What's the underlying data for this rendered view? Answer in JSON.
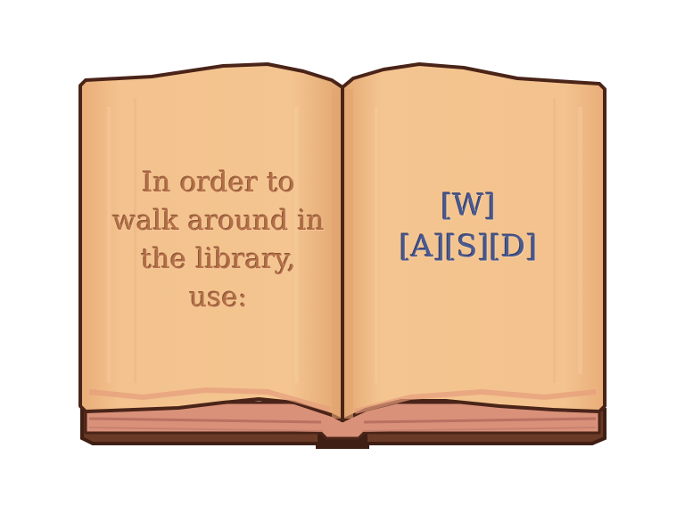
{
  "book": {
    "left_page": {
      "lines": [
        "In order to",
        "walk around in",
        "the library,",
        "use:"
      ]
    },
    "right_page": {
      "lines": [
        "[W]",
        "[A][S][D]"
      ]
    }
  },
  "colors": {
    "page_light": "#f5c896",
    "page_mid": "#efbb85",
    "page_shadow": "#e0a56e",
    "outline": "#4a2418",
    "cover": "#6b3a26",
    "cover_dark": "#3f1f14",
    "page_edges": "#d9917a",
    "left_text": "#b36f47",
    "right_text": "#4a5a90"
  }
}
